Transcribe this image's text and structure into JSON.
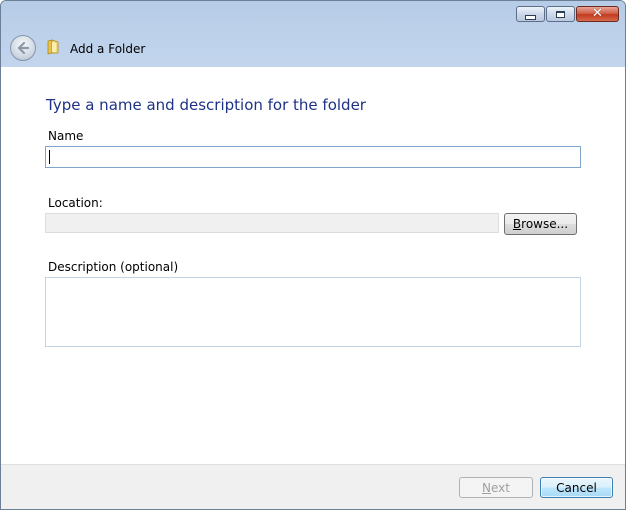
{
  "window": {
    "title": "Add a Folder",
    "caption_close": "✕"
  },
  "form": {
    "heading": "Type a name and description for the folder",
    "name_label": "Name",
    "name_value": "",
    "location_label": "Location:",
    "location_value": "",
    "browse_prefix": "",
    "browse_access_key": "B",
    "browse_rest": "rowse...",
    "description_label": "Description (optional)",
    "description_value": ""
  },
  "footer": {
    "next_access_key": "N",
    "next_rest": "ext",
    "cancel_label": "Cancel"
  },
  "colors": {
    "heading": "#1e3287",
    "titlebar": "#bcd0ea",
    "footer": "#f0f0f0"
  },
  "icons": {
    "back": "back-arrow-icon",
    "folder": "folder-icon"
  }
}
